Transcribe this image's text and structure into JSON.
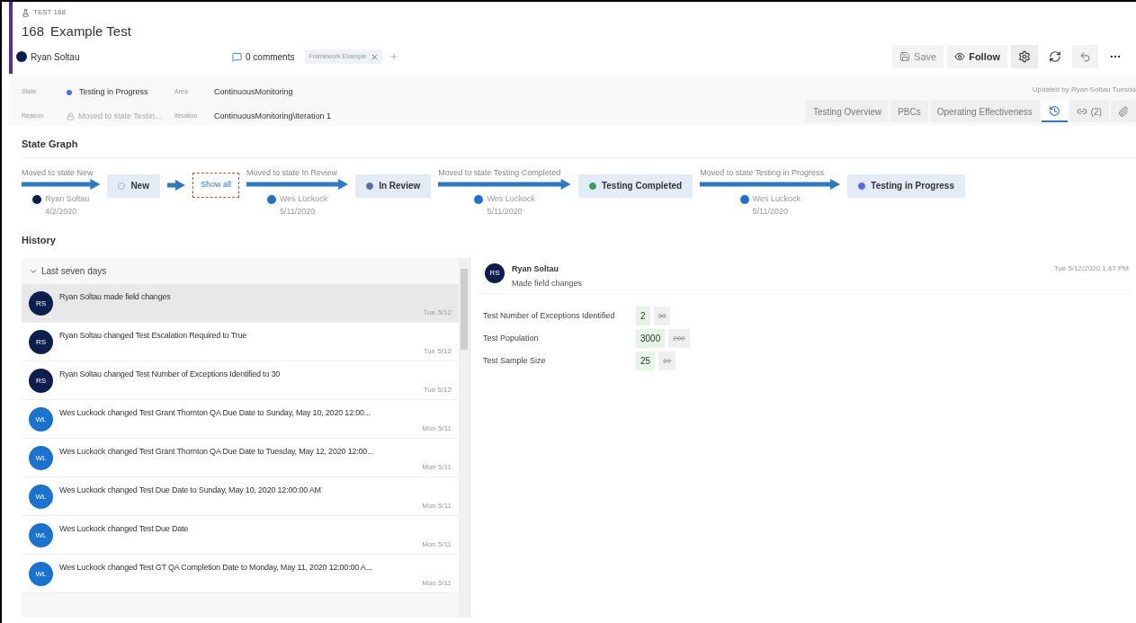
{
  "work_item": {
    "type_label": "TEST 168",
    "id": "168",
    "title": "Example Test",
    "assigned_to": {
      "name": "Ryan Soltau"
    },
    "comments": "0 comments",
    "tags": [
      "Framework Example"
    ]
  },
  "toolbar": [
    {
      "kind": "save",
      "label": "Save",
      "disabled": true
    },
    {
      "kind": "follow",
      "label": "Follow",
      "disabled": false
    },
    {
      "kind": "settings",
      "disabled": false
    },
    {
      "kind": "refresh",
      "disabled": false
    },
    {
      "kind": "undo",
      "disabled": true
    },
    {
      "kind": "more",
      "disabled": false
    }
  ],
  "fields": {
    "state_label": "State",
    "state": "Testing in Progress",
    "reason_label": "Reason",
    "reason": "Moved to state Testin...",
    "area_label": "Area",
    "area": "ContinuousMonitoring",
    "iteration_label": "Iteration",
    "iteration": "ContinuousMonitoring\\Iteration 1"
  },
  "updated_by": "Updated by Ryan Soltau Tuesda",
  "page_tabs": [
    {
      "kind": "text",
      "label": "Testing Overview",
      "selected": false
    },
    {
      "kind": "text",
      "label": "PBCs",
      "selected": false
    },
    {
      "kind": "text",
      "label": "Operating Effectiveness",
      "selected": false
    },
    {
      "kind": "history",
      "selected": true
    },
    {
      "kind": "links",
      "label": "(2)",
      "selected": false
    },
    {
      "kind": "attachments",
      "selected": false
    }
  ],
  "state_graph": {
    "title": "State Graph",
    "steps": [
      {
        "kind": "transition",
        "label": "Moved to state New",
        "user": {
          "name": "Ryan Soltau",
          "color": "#0b1f4d"
        },
        "date": "4/2/2020"
      },
      {
        "kind": "state",
        "name": "New",
        "color": "#b4b4b4"
      },
      {
        "kind": "show_all",
        "label": "Show all"
      },
      {
        "kind": "transition",
        "label": "Moved to state In Review",
        "user": {
          "name": "Wes Luckock",
          "color": "#1a73d0"
        },
        "date": "5/11/2020"
      },
      {
        "kind": "state",
        "name": "In Review",
        "color": "#5a6fa8"
      },
      {
        "kind": "transition",
        "label": "Moved to state Testing Completed",
        "user": {
          "name": "Wes Luckock",
          "color": "#1a73d0"
        },
        "date": "5/11/2020"
      },
      {
        "kind": "state",
        "name": "Testing Completed",
        "color": "#3f9d58"
      },
      {
        "kind": "transition",
        "label": "Moved to state Testing in Progress",
        "user": {
          "name": "Wes Luckock",
          "color": "#1a73d0"
        },
        "date": "5/11/2020"
      },
      {
        "kind": "state",
        "name": "Testing in Progress",
        "color": "#4f6bed"
      }
    ]
  },
  "history": {
    "title": "History",
    "group": {
      "label": "Last seven days",
      "expanded": true
    },
    "items": [
      {
        "initials": "RS",
        "color": "#0b1f4d",
        "text": "Ryan Soltau made field changes",
        "date": "Tue 5/12",
        "selected": true
      },
      {
        "initials": "RS",
        "color": "#0b1f4d",
        "text": "Ryan Soltau changed Test Escalation Required to True",
        "date": "Tue 5/12",
        "selected": false
      },
      {
        "initials": "RS",
        "color": "#0b1f4d",
        "text": "Ryan Soltau changed Test Number of Exceptions Identified to 30",
        "date": "Tue 5/12",
        "selected": false
      },
      {
        "initials": "WL",
        "color": "#1a73d0",
        "text": "Wes Luckock changed Test Grant Thornton QA Due Date to Sunday, May 10, 2020 12:00...",
        "date": "Mon 5/11",
        "selected": false
      },
      {
        "initials": "WL",
        "color": "#1a73d0",
        "text": "Wes Luckock changed Test Grant Thornton QA Due Date to Tuesday, May 12, 2020 12:00...",
        "date": "Mon 5/11",
        "selected": false
      },
      {
        "initials": "WL",
        "color": "#1a73d0",
        "text": "Wes Luckock changed Test Due Date to Sunday, May 10, 2020 12:00:00 AM",
        "date": "Mon 5/11",
        "selected": false
      },
      {
        "initials": "WL",
        "color": "#1a73d0",
        "text": "Wes Luckock changed Test Due Date",
        "date": "Mon 5/11",
        "selected": false
      },
      {
        "initials": "WL",
        "color": "#1a73d0",
        "text": "Wes Luckock changed Test GT QA Completion Date to Monday, May 11, 2020 12:00:00 A...",
        "date": "Mon 5/11",
        "selected": false
      }
    ],
    "detail": {
      "initials": "RS",
      "color": "#0b1f4d",
      "name": "Ryan Soltau",
      "summary": "Made field changes",
      "date": "Tue 5/12/2020 1:47 PM",
      "changes": [
        {
          "field": "Test Number of Exceptions Identified",
          "new": "2",
          "old": "30"
        },
        {
          "field": "Test Population",
          "new": "3000",
          "old": "200"
        },
        {
          "field": "Test Sample Size",
          "new": "25",
          "old": "20"
        }
      ]
    }
  }
}
